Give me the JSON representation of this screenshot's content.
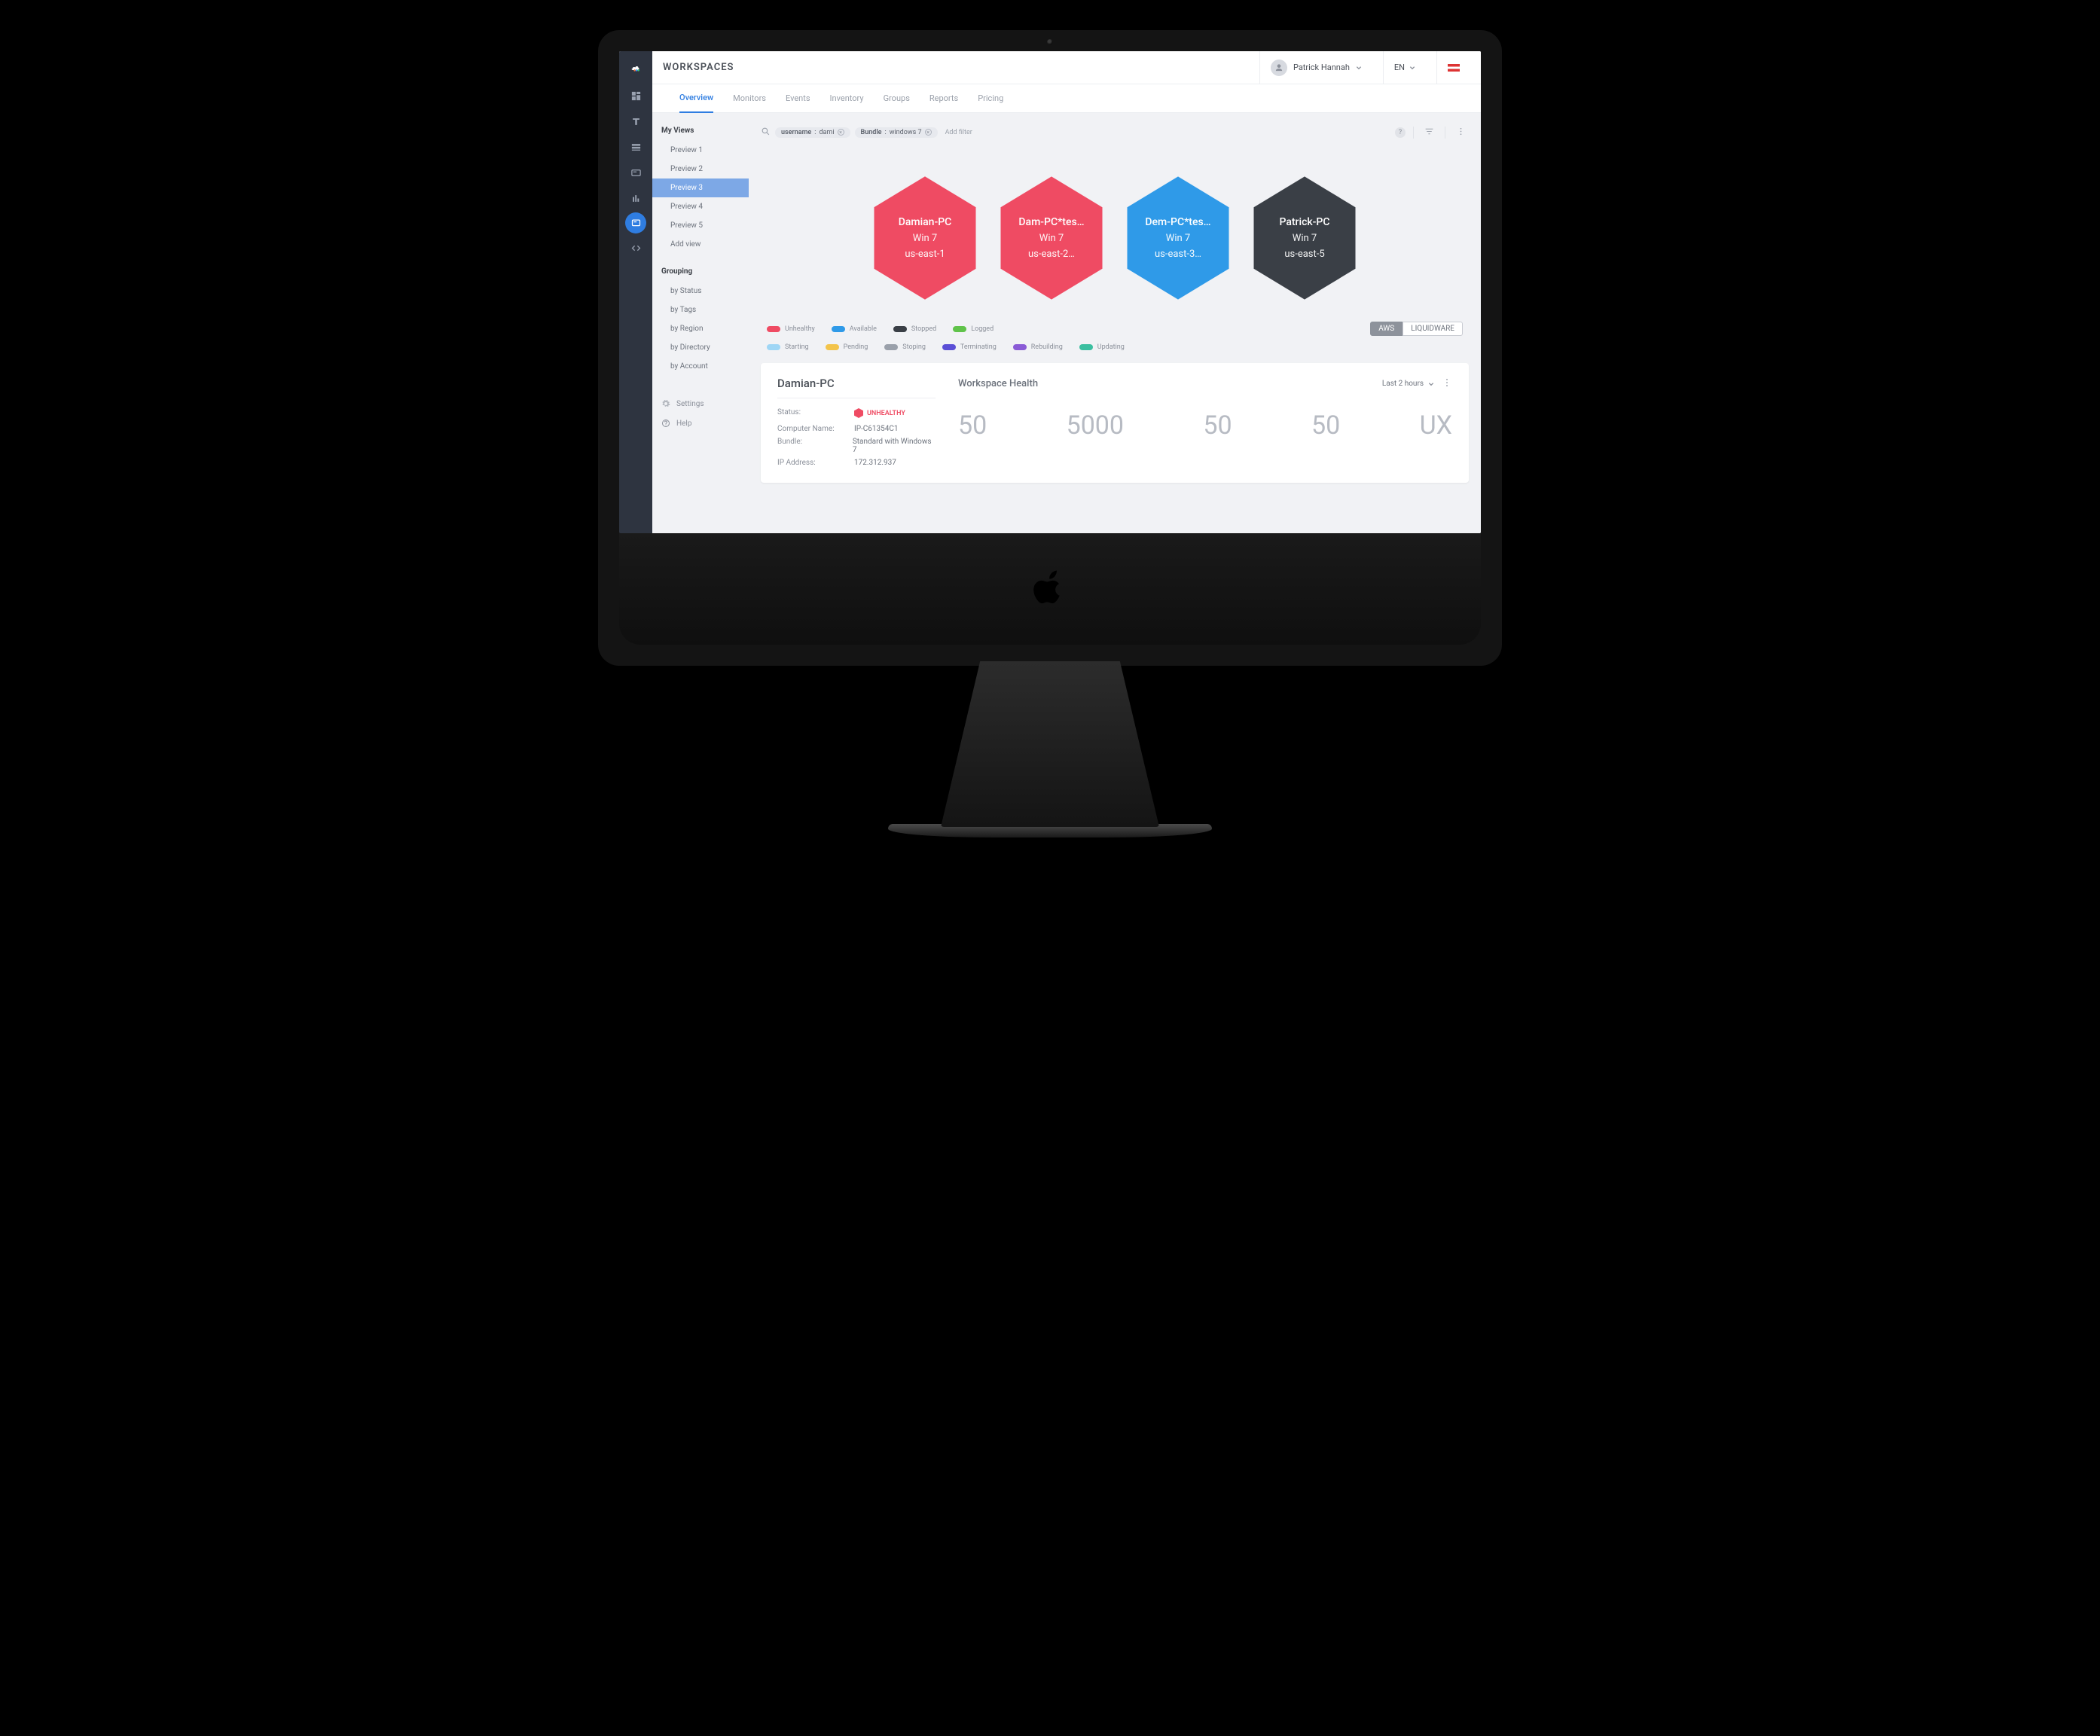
{
  "header": {
    "title": "WORKSPACES",
    "user_name": "Patrick Hannah",
    "language": "EN"
  },
  "tabs": [
    {
      "label": "Overview",
      "active": true
    },
    {
      "label": "Monitors"
    },
    {
      "label": "Events"
    },
    {
      "label": "Inventory"
    },
    {
      "label": "Groups"
    },
    {
      "label": "Reports"
    },
    {
      "label": "Pricing"
    }
  ],
  "sidebar": {
    "views_title": "My Views",
    "views": [
      {
        "label": "Preview 1"
      },
      {
        "label": "Preview 2"
      },
      {
        "label": "Preview 3",
        "active": true
      },
      {
        "label": "Preview 4"
      },
      {
        "label": "Preview 5"
      },
      {
        "label": "Add view"
      }
    ],
    "grouping_title": "Grouping",
    "grouping": [
      {
        "label": "by Status"
      },
      {
        "label": "by Tags"
      },
      {
        "label": "by Region"
      },
      {
        "label": "by Directory"
      },
      {
        "label": "by Account"
      }
    ],
    "settings_label": "Settings",
    "help_label": "Help"
  },
  "filters": {
    "chips": [
      {
        "key": "username",
        "value": "dami"
      },
      {
        "key": "Bundle",
        "value": "windows 7"
      }
    ],
    "add_label": "Add filter"
  },
  "hexes": [
    {
      "name": "Damian-PC",
      "os": "Win 7",
      "region": "us-east-1",
      "color": "pink",
      "selected": true
    },
    {
      "name": "Dam-PC*tes…",
      "os": "Win 7",
      "region": "us-east-2…",
      "color": "pink"
    },
    {
      "name": "Dem-PC*tes…",
      "os": "Win 7",
      "region": "us-east-3…",
      "color": "blue"
    },
    {
      "name": "Patrick-PC",
      "os": "Win 7",
      "region": "us-east-5",
      "color": "dark"
    }
  ],
  "legend": {
    "row1": [
      {
        "label": "Unhealthy",
        "color": "#ef4b63"
      },
      {
        "label": "Available",
        "color": "#2f9ae8"
      },
      {
        "label": "Stopped",
        "color": "#3a3f46"
      },
      {
        "label": "Logged",
        "color": "#60c34a"
      }
    ],
    "row2": [
      {
        "label": "Starting",
        "color": "#9fd6f5"
      },
      {
        "label": "Pending",
        "color": "#f3c44b"
      },
      {
        "label": "Stoping",
        "color": "#9aa0aa"
      },
      {
        "label": "Terminating",
        "color": "#5b4fd6"
      },
      {
        "label": "Rebuilding",
        "color": "#8a5bd6"
      },
      {
        "label": "Updating",
        "color": "#3bbfa0"
      }
    ],
    "toggle_left": "AWS",
    "toggle_right": "LIQUIDWARE"
  },
  "detail": {
    "title": "Damian-PC",
    "health_title": "Workspace Health",
    "range": "Last 2 hours",
    "rows": [
      {
        "k": "Status:",
        "badge": "UNHEALTHY"
      },
      {
        "k": "Computer Name:",
        "v": "IP-C61354C1"
      },
      {
        "k": "Bundle:",
        "v": "Standard with Windows 7"
      },
      {
        "k": "IP Address:",
        "v": "172.312.937"
      }
    ],
    "metrics": [
      "50",
      "5000",
      "50",
      "50",
      "UX"
    ]
  }
}
